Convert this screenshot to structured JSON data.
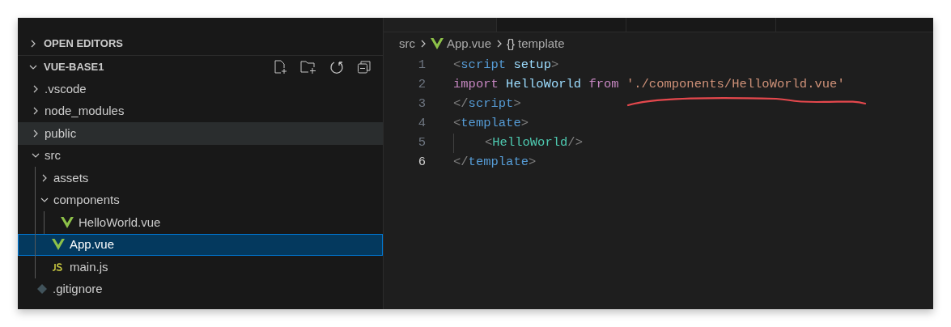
{
  "sidebar": {
    "sections": [
      {
        "label": "OPEN EDITORS",
        "expanded": false
      },
      {
        "label": "VUE-BASE1",
        "expanded": true
      }
    ],
    "tree": [
      {
        "name": ".vscode",
        "kind": "folder",
        "expanded": false,
        "selected": false,
        "hovered": false
      },
      {
        "name": "node_modules",
        "kind": "folder",
        "expanded": false,
        "selected": false,
        "hovered": false
      },
      {
        "name": "public",
        "kind": "folder",
        "expanded": false,
        "selected": false,
        "hovered": true
      },
      {
        "name": "src",
        "kind": "folder",
        "expanded": true,
        "selected": false,
        "hovered": false,
        "children": [
          {
            "name": "assets",
            "kind": "folder",
            "expanded": false,
            "selected": false,
            "hovered": false
          },
          {
            "name": "components",
            "kind": "folder",
            "expanded": true,
            "selected": false,
            "hovered": false,
            "children": [
              {
                "name": "HelloWorld.vue",
                "kind": "vue",
                "selected": false,
                "hovered": false
              }
            ]
          },
          {
            "name": "App.vue",
            "kind": "vue",
            "selected": true,
            "hovered": false
          },
          {
            "name": "main.js",
            "kind": "js",
            "selected": false,
            "hovered": false
          }
        ]
      },
      {
        "name": ".gitignore",
        "kind": "git",
        "selected": false,
        "hovered": false
      }
    ]
  },
  "breadcrumbs": [
    {
      "label": "src",
      "kind": "text"
    },
    {
      "label": "App.vue",
      "kind": "vue"
    },
    {
      "label": "template",
      "kind": "symbol",
      "icon": "{}"
    }
  ],
  "code": [
    {
      "number": "1",
      "active": false,
      "tokens": [
        {
          "t": "<",
          "kind": "punct"
        },
        {
          "t": "script",
          "kind": "tag"
        },
        {
          "t": "setup",
          "kind": "attr",
          "spaced": true
        },
        {
          "t": ">",
          "kind": "punct"
        }
      ]
    },
    {
      "number": "2",
      "active": false,
      "tokens": [
        {
          "t": "import",
          "kind": "keyword"
        },
        {
          "t": "HelloWorld",
          "kind": "attr",
          "spaced": true
        },
        {
          "t": "from",
          "kind": "keyword",
          "spaced": true
        },
        {
          "t": "'./components/HelloWorld.vue'",
          "kind": "string",
          "spaced": true
        }
      ]
    },
    {
      "number": "3",
      "active": false,
      "tokens": [
        {
          "t": "</",
          "kind": "punct"
        },
        {
          "t": "script",
          "kind": "tag"
        },
        {
          "t": ">",
          "kind": "punct"
        }
      ]
    },
    {
      "number": "4",
      "active": false,
      "tokens": [
        {
          "t": "<",
          "kind": "punct"
        },
        {
          "t": "template",
          "kind": "tag"
        },
        {
          "t": ">",
          "kind": "punct"
        }
      ]
    },
    {
      "number": "5",
      "active": false,
      "indent": true,
      "tokens": [
        {
          "t": "<",
          "kind": "punct"
        },
        {
          "t": "HelloWorld",
          "kind": "component"
        },
        {
          "t": "/>",
          "kind": "punct"
        }
      ]
    },
    {
      "number": "6",
      "active": true,
      "tokens": [
        {
          "t": "</",
          "kind": "punct"
        },
        {
          "t": "template",
          "kind": "tag"
        },
        {
          "t": ">",
          "kind": "punct"
        }
      ]
    }
  ]
}
